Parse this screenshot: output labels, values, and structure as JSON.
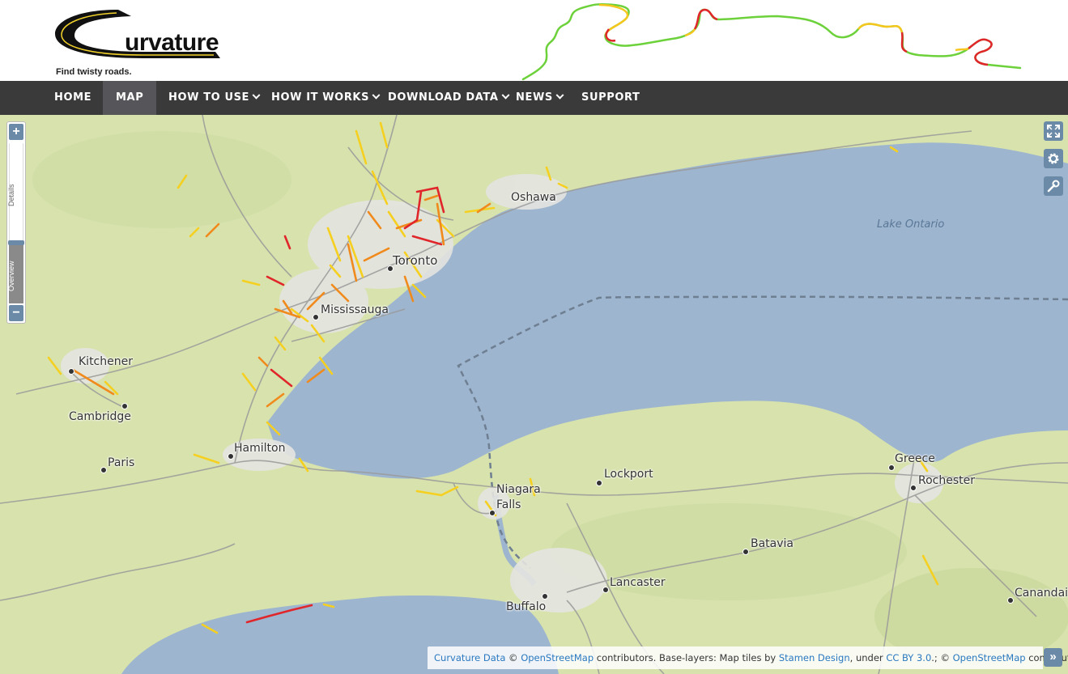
{
  "header": {
    "logo_text": "urvature",
    "tagline": "Find twisty roads."
  },
  "nav": {
    "items": [
      {
        "label": "HOME",
        "active": false,
        "dropdown": false
      },
      {
        "label": "MAP",
        "active": true,
        "dropdown": false
      },
      {
        "label": "HOW TO USE",
        "active": false,
        "dropdown": true
      },
      {
        "label": "HOW IT WORKS",
        "active": false,
        "dropdown": true
      },
      {
        "label": "DOWNLOAD DATA",
        "active": false,
        "dropdown": true
      },
      {
        "label": "NEWS",
        "active": false,
        "dropdown": true
      },
      {
        "label": "SUPPORT",
        "active": false,
        "dropdown": false
      }
    ]
  },
  "map": {
    "zoom_in": "+",
    "zoom_out": "−",
    "layer_labels": {
      "details": "Details",
      "overview": "Overview"
    },
    "lake_label": "Lake Ontario",
    "cities": [
      {
        "name": "Oshawa"
      },
      {
        "name": "Toronto"
      },
      {
        "name": "Mississauga"
      },
      {
        "name": "Kitchener"
      },
      {
        "name": "Cambridge"
      },
      {
        "name": "Hamilton"
      },
      {
        "name": "Paris"
      },
      {
        "name": "Niagara"
      },
      {
        "name": "Falls"
      },
      {
        "name": "Lockport"
      },
      {
        "name": "Greece"
      },
      {
        "name": "Rochester"
      },
      {
        "name": "Batavia"
      },
      {
        "name": "Lancaster"
      },
      {
        "name": "Buffalo"
      },
      {
        "name": "Canandaigua"
      }
    ],
    "tools": [
      "fullscreen-icon",
      "gear-icon",
      "wrench-icon"
    ],
    "colors": {
      "land": "#d7e2ad",
      "water": "#9db5cf",
      "urban": "#e6e6e6",
      "curvy_yellow": "#f5d020",
      "curvy_orange": "#f08a1c",
      "curvy_red": "#e0262a"
    }
  },
  "attribution": {
    "link1": "Curvature Data",
    "copy1": " © ",
    "link2": "OpenStreetMap",
    "text2": " contributors. Base-layers: Map tiles by ",
    "link3": "Stamen Design",
    "text3": ", under ",
    "link4": "CC BY 3.0",
    "text4": ".; © ",
    "link5": "OpenStreetMap",
    "text5": " contributors.",
    "toggle": "»"
  }
}
